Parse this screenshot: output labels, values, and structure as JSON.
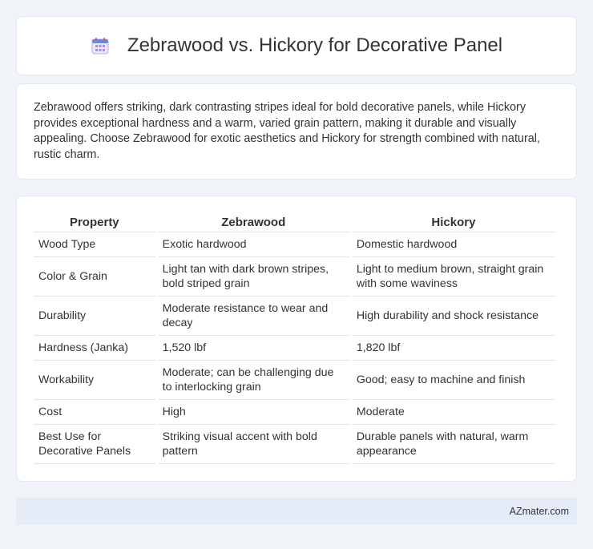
{
  "header": {
    "icon": "calendar-icon",
    "title": "Zebrawood vs. Hickory for Decorative Panel"
  },
  "summary": {
    "text": "Zebrawood offers striking, dark contrasting stripes ideal for bold decorative panels, while Hickory provides exceptional hardness and a warm, varied grain pattern, making it durable and visually appealing. Choose Zebrawood for exotic aesthetics and Hickory for strength combined with natural, rustic charm."
  },
  "table": {
    "headers": [
      "Property",
      "Zebrawood",
      "Hickory"
    ],
    "rows": [
      [
        "Wood Type",
        "Exotic hardwood",
        "Domestic hardwood"
      ],
      [
        "Color & Grain",
        "Light tan with dark brown stripes, bold striped grain",
        "Light to medium brown, straight grain with some waviness"
      ],
      [
        "Durability",
        "Moderate resistance to wear and decay",
        "High durability and shock resistance"
      ],
      [
        "Hardness (Janka)",
        "1,520 lbf",
        "1,820 lbf"
      ],
      [
        "Workability",
        "Moderate; can be challenging due to interlocking grain",
        "Good; easy to machine and finish"
      ],
      [
        "Cost",
        "High",
        "Moderate"
      ],
      [
        "Best Use for Decorative Panels",
        "Striking visual accent with bold pattern",
        "Durable panels with natural, warm appearance"
      ]
    ]
  },
  "footer": {
    "text": "AZmater.com"
  }
}
